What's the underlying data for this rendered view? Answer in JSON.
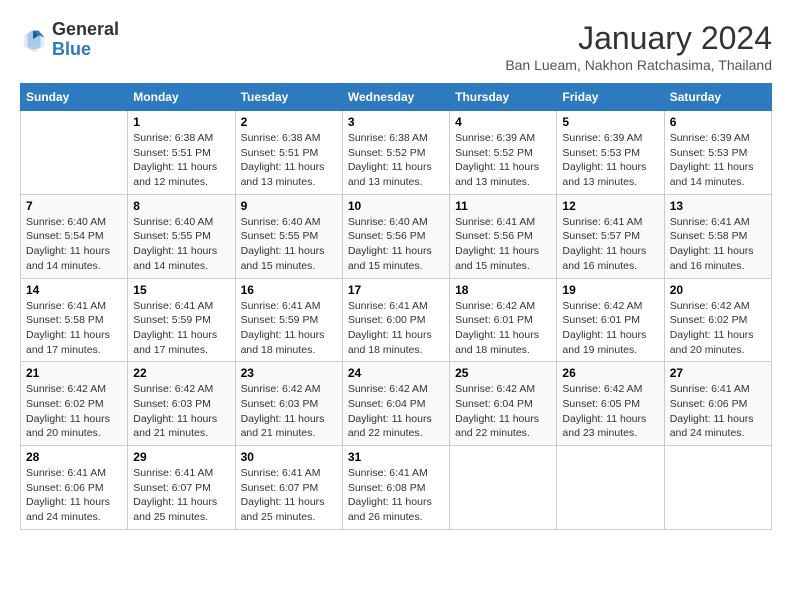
{
  "header": {
    "logo_general": "General",
    "logo_blue": "Blue",
    "month_year": "January 2024",
    "location": "Ban Lueam, Nakhon Ratchasima, Thailand"
  },
  "columns": [
    "Sunday",
    "Monday",
    "Tuesday",
    "Wednesday",
    "Thursday",
    "Friday",
    "Saturday"
  ],
  "weeks": [
    [
      {
        "day": "",
        "info": ""
      },
      {
        "day": "1",
        "info": "Sunrise: 6:38 AM\nSunset: 5:51 PM\nDaylight: 11 hours and 12 minutes."
      },
      {
        "day": "2",
        "info": "Sunrise: 6:38 AM\nSunset: 5:51 PM\nDaylight: 11 hours and 13 minutes."
      },
      {
        "day": "3",
        "info": "Sunrise: 6:38 AM\nSunset: 5:52 PM\nDaylight: 11 hours and 13 minutes."
      },
      {
        "day": "4",
        "info": "Sunrise: 6:39 AM\nSunset: 5:52 PM\nDaylight: 11 hours and 13 minutes."
      },
      {
        "day": "5",
        "info": "Sunrise: 6:39 AM\nSunset: 5:53 PM\nDaylight: 11 hours and 13 minutes."
      },
      {
        "day": "6",
        "info": "Sunrise: 6:39 AM\nSunset: 5:53 PM\nDaylight: 11 hours and 14 minutes."
      }
    ],
    [
      {
        "day": "7",
        "info": "Sunrise: 6:40 AM\nSunset: 5:54 PM\nDaylight: 11 hours and 14 minutes."
      },
      {
        "day": "8",
        "info": "Sunrise: 6:40 AM\nSunset: 5:55 PM\nDaylight: 11 hours and 14 minutes."
      },
      {
        "day": "9",
        "info": "Sunrise: 6:40 AM\nSunset: 5:55 PM\nDaylight: 11 hours and 15 minutes."
      },
      {
        "day": "10",
        "info": "Sunrise: 6:40 AM\nSunset: 5:56 PM\nDaylight: 11 hours and 15 minutes."
      },
      {
        "day": "11",
        "info": "Sunrise: 6:41 AM\nSunset: 5:56 PM\nDaylight: 11 hours and 15 minutes."
      },
      {
        "day": "12",
        "info": "Sunrise: 6:41 AM\nSunset: 5:57 PM\nDaylight: 11 hours and 16 minutes."
      },
      {
        "day": "13",
        "info": "Sunrise: 6:41 AM\nSunset: 5:58 PM\nDaylight: 11 hours and 16 minutes."
      }
    ],
    [
      {
        "day": "14",
        "info": "Sunrise: 6:41 AM\nSunset: 5:58 PM\nDaylight: 11 hours and 17 minutes."
      },
      {
        "day": "15",
        "info": "Sunrise: 6:41 AM\nSunset: 5:59 PM\nDaylight: 11 hours and 17 minutes."
      },
      {
        "day": "16",
        "info": "Sunrise: 6:41 AM\nSunset: 5:59 PM\nDaylight: 11 hours and 18 minutes."
      },
      {
        "day": "17",
        "info": "Sunrise: 6:41 AM\nSunset: 6:00 PM\nDaylight: 11 hours and 18 minutes."
      },
      {
        "day": "18",
        "info": "Sunrise: 6:42 AM\nSunset: 6:01 PM\nDaylight: 11 hours and 18 minutes."
      },
      {
        "day": "19",
        "info": "Sunrise: 6:42 AM\nSunset: 6:01 PM\nDaylight: 11 hours and 19 minutes."
      },
      {
        "day": "20",
        "info": "Sunrise: 6:42 AM\nSunset: 6:02 PM\nDaylight: 11 hours and 20 minutes."
      }
    ],
    [
      {
        "day": "21",
        "info": "Sunrise: 6:42 AM\nSunset: 6:02 PM\nDaylight: 11 hours and 20 minutes."
      },
      {
        "day": "22",
        "info": "Sunrise: 6:42 AM\nSunset: 6:03 PM\nDaylight: 11 hours and 21 minutes."
      },
      {
        "day": "23",
        "info": "Sunrise: 6:42 AM\nSunset: 6:03 PM\nDaylight: 11 hours and 21 minutes."
      },
      {
        "day": "24",
        "info": "Sunrise: 6:42 AM\nSunset: 6:04 PM\nDaylight: 11 hours and 22 minutes."
      },
      {
        "day": "25",
        "info": "Sunrise: 6:42 AM\nSunset: 6:04 PM\nDaylight: 11 hours and 22 minutes."
      },
      {
        "day": "26",
        "info": "Sunrise: 6:42 AM\nSunset: 6:05 PM\nDaylight: 11 hours and 23 minutes."
      },
      {
        "day": "27",
        "info": "Sunrise: 6:41 AM\nSunset: 6:06 PM\nDaylight: 11 hours and 24 minutes."
      }
    ],
    [
      {
        "day": "28",
        "info": "Sunrise: 6:41 AM\nSunset: 6:06 PM\nDaylight: 11 hours and 24 minutes."
      },
      {
        "day": "29",
        "info": "Sunrise: 6:41 AM\nSunset: 6:07 PM\nDaylight: 11 hours and 25 minutes."
      },
      {
        "day": "30",
        "info": "Sunrise: 6:41 AM\nSunset: 6:07 PM\nDaylight: 11 hours and 25 minutes."
      },
      {
        "day": "31",
        "info": "Sunrise: 6:41 AM\nSunset: 6:08 PM\nDaylight: 11 hours and 26 minutes."
      },
      {
        "day": "",
        "info": ""
      },
      {
        "day": "",
        "info": ""
      },
      {
        "day": "",
        "info": ""
      }
    ]
  ]
}
